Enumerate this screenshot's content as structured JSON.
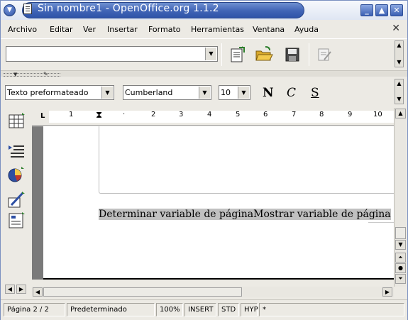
{
  "window": {
    "title": "Sin nombre1 - OpenOffice.org 1.1.2"
  },
  "menu": {
    "items": [
      "Archivo",
      "Editar",
      "Ver",
      "Insertar",
      "Formato",
      "Herramientas",
      "Ventana",
      "Ayuda"
    ]
  },
  "function_bar": {
    "url_value": "",
    "icons": [
      "edit-file-icon",
      "open-folder-icon",
      "save-icon",
      "edit-mode-icon"
    ]
  },
  "object_bar": {
    "paragraph_style": "Texto preformateado",
    "font_name": "Cumberland",
    "font_size": "10",
    "bold_label": "N",
    "italic_label": "C",
    "underline_label": "S"
  },
  "left_toolbar": {
    "icons": [
      "insert-table-icon",
      "insert-fields-icon",
      "insert-object-icon",
      "draw-functions-icon",
      "form-controls-icon"
    ]
  },
  "ruler": {
    "labels": [
      "1",
      "2",
      "3",
      "4",
      "5",
      "6",
      "7",
      "8",
      "9",
      "10"
    ]
  },
  "document": {
    "field1": "Determinar variable de página",
    "field2": "Mostrar variable de página"
  },
  "status": {
    "page": "Página  2 / 2",
    "style": "Predeterminado",
    "zoom": "100%",
    "insert": "INSERT",
    "selection": "STD",
    "hyperlink": "HYP",
    "modified": "*"
  },
  "colors": {
    "title_bar": "#3f63b5",
    "field_shading": "#c0c0c0",
    "page_background": "#7a7a7a"
  }
}
